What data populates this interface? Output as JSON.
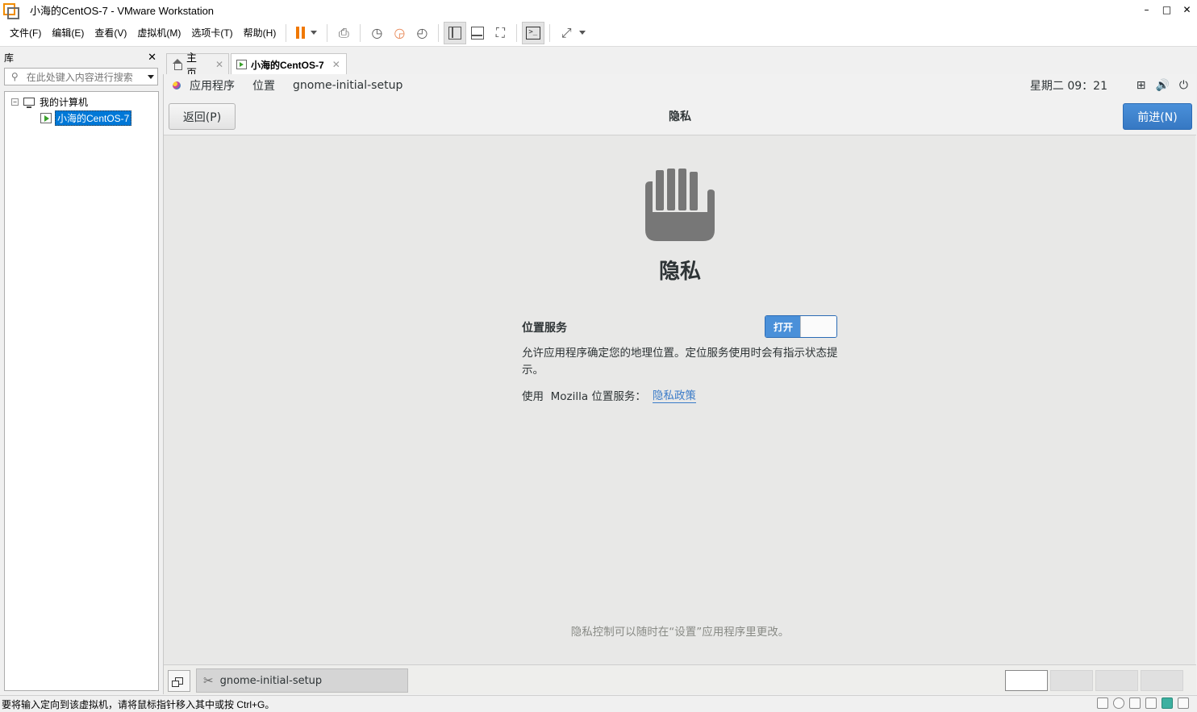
{
  "window": {
    "title": "小海的CentOS-7 - VMware Workstation",
    "minimize": "–",
    "maximize": "□",
    "close": "✕"
  },
  "menubar": {
    "items": [
      "文件(F)",
      "编辑(E)",
      "查看(V)",
      "虚拟机(M)",
      "选项卡(T)",
      "帮助(H)"
    ]
  },
  "library": {
    "title": "库",
    "close": "✕",
    "search_placeholder": "在此处键入内容进行搜索",
    "tree": {
      "root_label": "我的计算机",
      "root_expander": "−",
      "vm_label": "小海的CentOS-7"
    }
  },
  "tabs": [
    {
      "label": "主页",
      "close": "✕"
    },
    {
      "label": "小海的CentOS-7",
      "close": "✕"
    }
  ],
  "gnome": {
    "menus": [
      "应用程序",
      "位置",
      "gnome-initial-setup"
    ],
    "clock": "星期二 09：21",
    "sys_icons": [
      "network-icon",
      "volume-icon",
      "power-icon"
    ]
  },
  "setup": {
    "back_label": "返回(P)",
    "header_title": "隐私",
    "next_label": "前进(N)",
    "page_title": "隐私",
    "location_label": "位置服务",
    "toggle_on_label": "打开",
    "toggle_state": "on",
    "location_description": "允许应用程序确定您的地理位置。定位服务使用时会有指示状态提示。",
    "mozilla_text": "使用  Mozilla 位置服务：",
    "policy_link": "隐私政策",
    "footer_note": "隐私控制可以随时在“设置”应用程序里更改。"
  },
  "taskbar": {
    "task_label": "gnome-initial-setup",
    "workspaces": 4,
    "active_workspace": 1
  },
  "statusbar": {
    "text": "要将输入定向到该虚拟机，请将鼠标指针移入其中或按 Ctrl+G。"
  },
  "colors": {
    "accent_blue": "#4a90d9",
    "pause_orange": "#f07800",
    "vm_bg": "#e8e8e7",
    "hand_gray": "#777777"
  }
}
